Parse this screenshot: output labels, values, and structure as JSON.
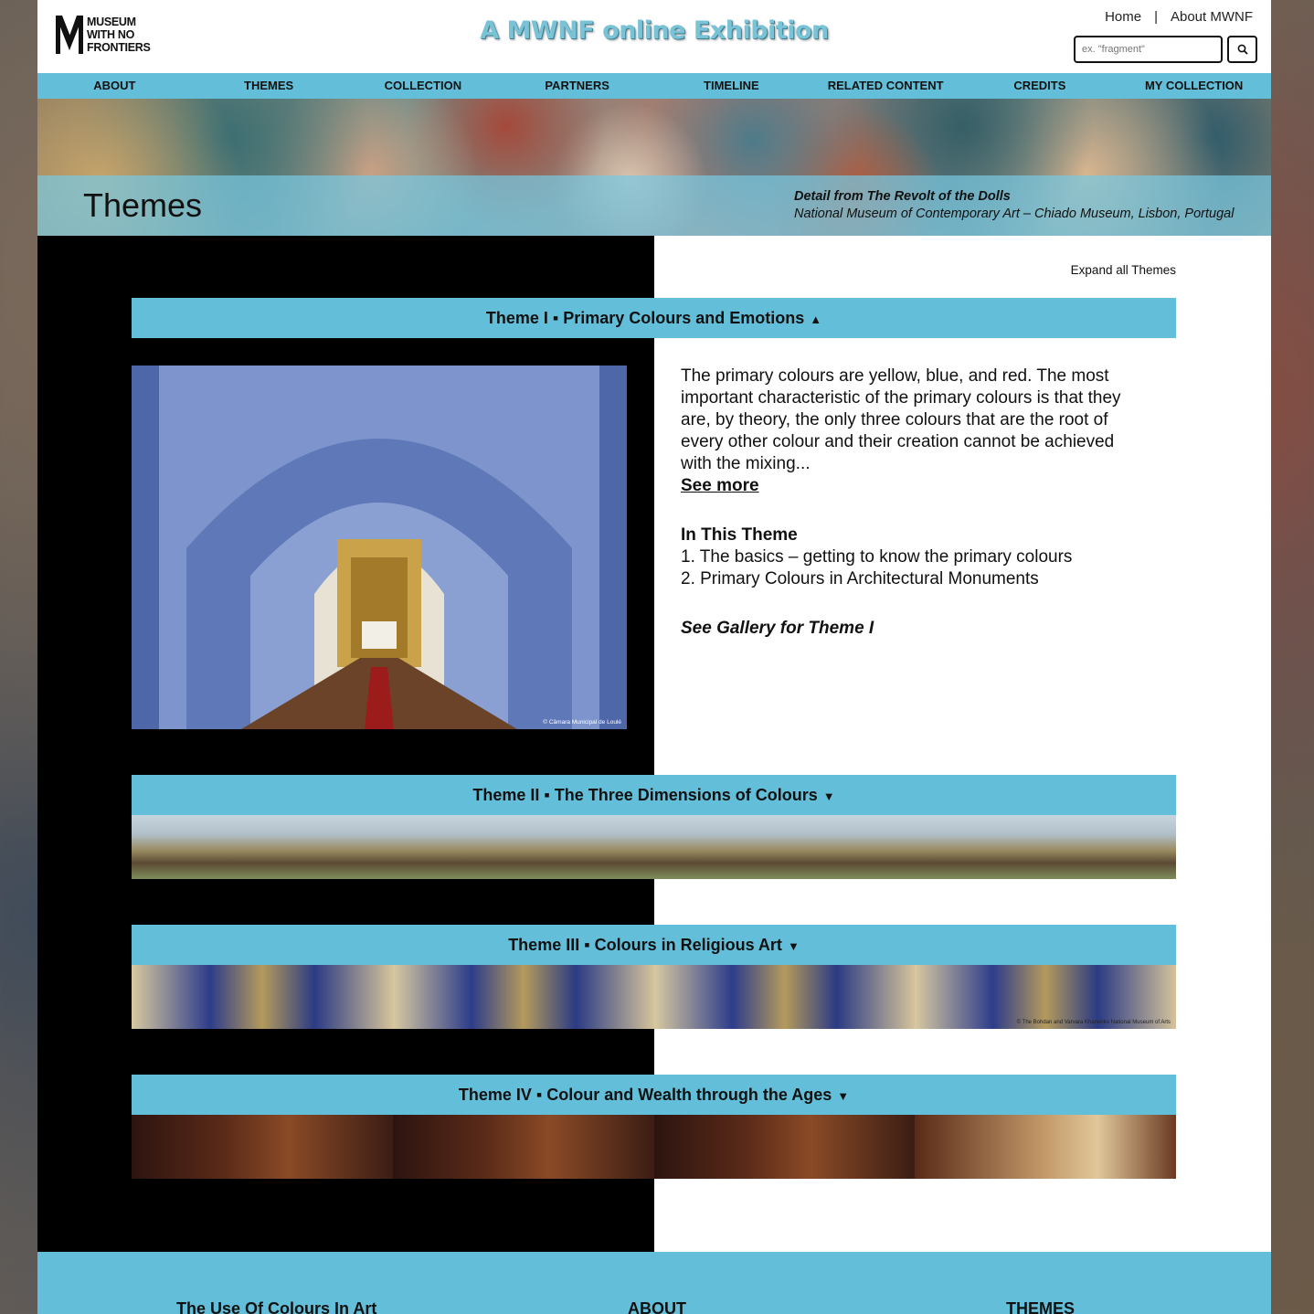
{
  "header": {
    "logo_lines": [
      "MUSEUM",
      "WITH NO",
      "FRONTIERS"
    ],
    "site_title": "A MWNF online Exhibition",
    "top_links": [
      "Home",
      "|",
      "About MWNF"
    ],
    "search_placeholder": "ex. \"fragment\"",
    "search_button_icon": "search-icon"
  },
  "nav": {
    "items": [
      "ABOUT",
      "THEMES",
      "COLLECTION",
      "PARTNERS",
      "TIMELINE",
      "RELATED CONTENT",
      "CREDITS",
      "MY COLLECTION"
    ]
  },
  "banner": {
    "title": "Themes",
    "caption_line1": "Detail from The Revolt of the Dolls",
    "caption_line2": "National Museum of Contemporary Art – Chiado Museum, Lisbon, Portugal"
  },
  "main": {
    "expand_all": "Expand all Themes",
    "themes": [
      {
        "title": "Theme I ▪ Primary Colours and Emotions",
        "caret": "▲",
        "description": "The primary colours are yellow, blue, and red. The most important characteristic of the primary colours is that they are, by theory, the only three colours that are the root of every other colour and their creation cannot be achieved with the mixing...",
        "see_more": "See more",
        "in_this_theme_label": "In This Theme",
        "items": [
          "1. The basics – getting to know the primary colours",
          "2. Primary Colours in Architectural Monuments"
        ],
        "gallery_link": "See Gallery for Theme I",
        "photo_credit": "© Câmara Municipal de Loulé"
      },
      {
        "title": "Theme II ▪ The Three Dimensions of Colours",
        "caret": "▼"
      },
      {
        "title": "Theme III ▪ Colours in Religious Art",
        "caret": "▼",
        "strip_credit": "© The Bohdan and Varvara Khanenko National Museum of Arts"
      },
      {
        "title": "Theme IV ▪ Colour and Wealth through the Ages",
        "caret": "▼"
      }
    ]
  },
  "footer": {
    "columns": [
      "The Use Of Colours In Art",
      "ABOUT",
      "THEMES"
    ]
  },
  "colors": {
    "accent": "#63bfd9",
    "title_color": "#7ac3d6"
  }
}
